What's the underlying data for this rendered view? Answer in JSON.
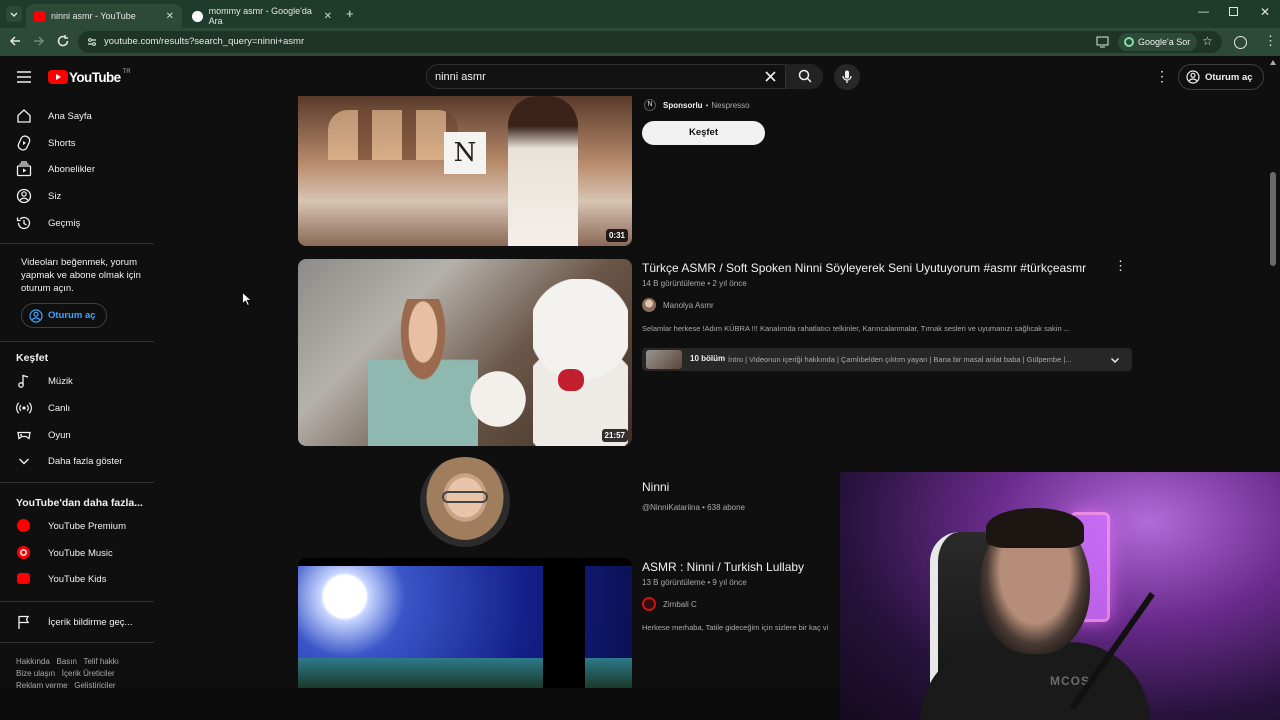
{
  "browser": {
    "tabs": [
      {
        "label": "ninni asmr - YouTube",
        "active": true
      },
      {
        "label": "mommy asmr - Google'da Ara",
        "active": false
      }
    ],
    "url": "youtube.com/results?search_query=ninni+asmr",
    "google_ask": "Google'a Sor"
  },
  "header": {
    "logo_text": "YouTube",
    "logo_region": "TR",
    "search_value": "ninni asmr",
    "signin_label": "Oturum aç"
  },
  "sidebar": {
    "items": [
      {
        "label": "Ana Sayfa",
        "icon": "home-icon"
      },
      {
        "label": "Shorts",
        "icon": "shorts-icon"
      },
      {
        "label": "Abonelikler",
        "icon": "subscriptions-icon"
      },
      {
        "label": "Siz",
        "icon": "you-icon"
      },
      {
        "label": "Geçmiş",
        "icon": "history-icon"
      }
    ],
    "signin_prompt": "Videoları beğenmek, yorum yapmak ve abone olmak için oturum açın.",
    "signin_button": "Oturum aç",
    "explore_title": "Keşfet",
    "explore": [
      {
        "label": "Müzik",
        "icon": "music-icon"
      },
      {
        "label": "Canlı",
        "icon": "live-icon"
      },
      {
        "label": "Oyun",
        "icon": "gaming-icon"
      },
      {
        "label": "Daha fazla göster",
        "icon": "chevron-down-icon"
      }
    ],
    "more_title": "YouTube'dan daha fazla...",
    "more": [
      {
        "label": "YouTube Premium"
      },
      {
        "label": "YouTube Music"
      },
      {
        "label": "YouTube Kids"
      }
    ],
    "report": "İçerik bildirme geç...",
    "footer_line1": "Hakkında   Basın   Telif hakkı",
    "footer_line2": "Bize ulaşın   İçerik Üreticiler",
    "footer_line3": "Reklam verme   Geliştiriciler"
  },
  "results": {
    "ad": {
      "sponsored": "Sponsorlu",
      "advertiser": "Nespresso",
      "cta": "Keşfet",
      "duration": "0:31"
    },
    "video1": {
      "title": "Türkçe ASMR / Soft Spoken Ninni Söyleyerek Seni Uyutuyorum #asmr #türkçeasmr",
      "meta": "14 B görüntüleme • 2 yıl önce",
      "channel": "Manolya Asmr",
      "description": "Selamlar herkese !Adım KÜBRA !!! Kanalımda rahatlatıcı telkinler, Karıncalanmalar, Tırnak sesleri ve uyumanızı sağlıcak sakin ...",
      "chapters_count": "10 bölüm",
      "chapters_text": "İntro | Videonun içeriği hakkında | Çamlıbelden çıktım yayan | Bana bir masal anlat baba | Gülpembe |...",
      "duration": "21:57"
    },
    "channel_result": {
      "name": "Ninni",
      "meta": "@NinniKatariina • 638 abone"
    },
    "video2": {
      "title": "ASMR : Ninni / Turkish Lullaby",
      "meta": "13 B görüntüleme • 9 yıl önce",
      "channel": "Zimbali C",
      "description": "Herkese merhaba, Tatile gideceğim için sizlere bir kaç vi"
    }
  },
  "colors": {
    "tabbar": "#1f3b2c",
    "omnibar": "#2d4a38",
    "yt_red": "#ff0000",
    "background": "#0f0f0f",
    "link_blue": "#3ea6ff"
  }
}
